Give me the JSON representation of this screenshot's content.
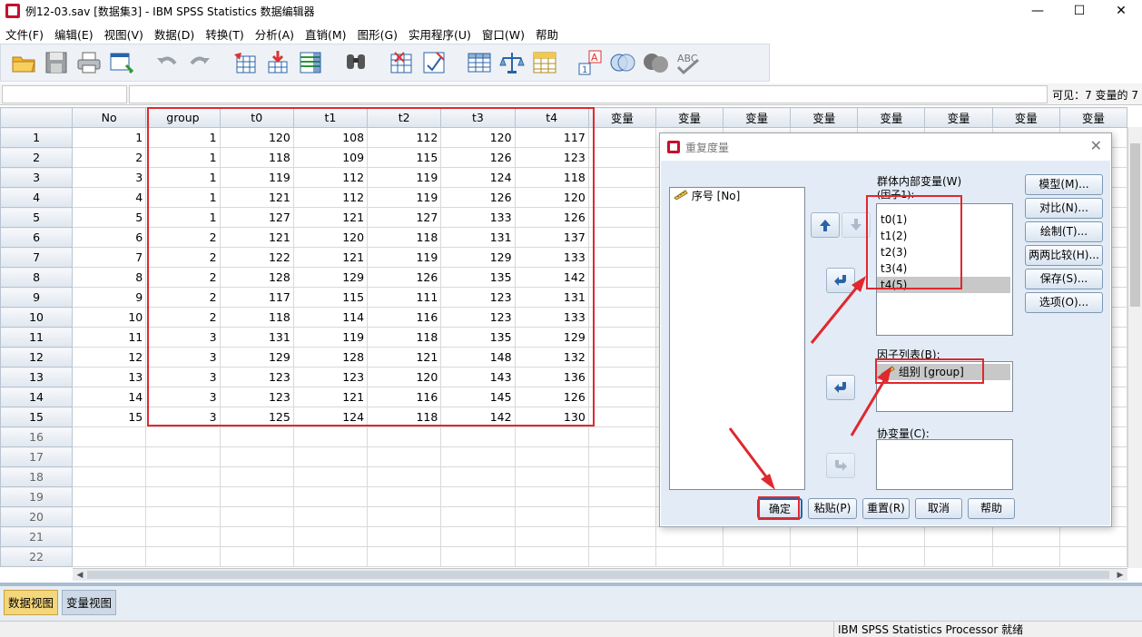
{
  "window": {
    "title": "例12-03.sav [数据集3] - IBM SPSS Statistics 数据编辑器",
    "min_glyph": "—",
    "max_glyph": "☐",
    "close_glyph": "✕"
  },
  "menu": [
    "文件(F)",
    "编辑(E)",
    "视图(V)",
    "数据(D)",
    "转换(T)",
    "分析(A)",
    "直销(M)",
    "图形(G)",
    "实用程序(U)",
    "窗口(W)",
    "帮助"
  ],
  "toolbar_icons": [
    "open-folder-icon",
    "save-icon",
    "print-icon",
    "dialog-recall-icon",
    "undo-icon",
    "redo-icon",
    "goto-case-icon",
    "goto-variable-icon",
    "variables-icon",
    "find-icon",
    "insert-cases-icon",
    "insert-variable-icon",
    "split-file-icon",
    "weight-cases-icon",
    "select-cases-icon",
    "value-labels-icon",
    "use-sets-icon",
    "show-all-variables-icon",
    "spell-check-icon"
  ],
  "editbar": {
    "visible_text": "可见：7 变量的 7"
  },
  "grid": {
    "columns": [
      "No",
      "group",
      "t0",
      "t1",
      "t2",
      "t3",
      "t4",
      "变量",
      "变量",
      "变量",
      "变量",
      "变量",
      "变量",
      "变量",
      "变量"
    ],
    "rows": [
      [
        "1",
        "1",
        "120",
        "108",
        "112",
        "120",
        "117"
      ],
      [
        "2",
        "1",
        "118",
        "109",
        "115",
        "126",
        "123"
      ],
      [
        "3",
        "1",
        "119",
        "112",
        "119",
        "124",
        "118"
      ],
      [
        "4",
        "1",
        "121",
        "112",
        "119",
        "126",
        "120"
      ],
      [
        "5",
        "1",
        "127",
        "121",
        "127",
        "133",
        "126"
      ],
      [
        "6",
        "2",
        "121",
        "120",
        "118",
        "131",
        "137"
      ],
      [
        "7",
        "2",
        "122",
        "121",
        "119",
        "129",
        "133"
      ],
      [
        "8",
        "2",
        "128",
        "129",
        "126",
        "135",
        "142"
      ],
      [
        "9",
        "2",
        "117",
        "115",
        "111",
        "123",
        "131"
      ],
      [
        "10",
        "2",
        "118",
        "114",
        "116",
        "123",
        "133"
      ],
      [
        "11",
        "3",
        "131",
        "119",
        "118",
        "135",
        "129"
      ],
      [
        "12",
        "3",
        "129",
        "128",
        "121",
        "148",
        "132"
      ],
      [
        "13",
        "3",
        "123",
        "123",
        "120",
        "143",
        "136"
      ],
      [
        "14",
        "3",
        "123",
        "121",
        "116",
        "145",
        "126"
      ],
      [
        "15",
        "3",
        "125",
        "124",
        "118",
        "142",
        "130"
      ]
    ],
    "empty_row_numbers": [
      "16",
      "17",
      "18",
      "19",
      "20",
      "21",
      "22"
    ]
  },
  "tabs": {
    "data_view": "数据视图",
    "variable_view": "变量视图"
  },
  "status": {
    "processor": "IBM SPSS Statistics Processor 就绪"
  },
  "dialog": {
    "title": "重复度量",
    "source_list": [
      "序号 [No]"
    ],
    "within_label": "群体内部变量(W)",
    "factor_label": "(因子1):",
    "within_items": [
      "t0(1)",
      "t1(2)",
      "t2(3)",
      "t3(4)",
      "t4(5)"
    ],
    "factor_list_label": "因子列表(B):",
    "factor_list_items": [
      "组别 [group]"
    ],
    "covariate_label": "协变量(C):",
    "side_buttons": [
      "模型(M)...",
      "对比(N)...",
      "绘制(T)...",
      "两两比较(H)...",
      "保存(S)...",
      "选项(O)..."
    ],
    "bottom_buttons": [
      "确定",
      "粘贴(P)",
      "重置(R)",
      "取消",
      "帮助"
    ]
  }
}
